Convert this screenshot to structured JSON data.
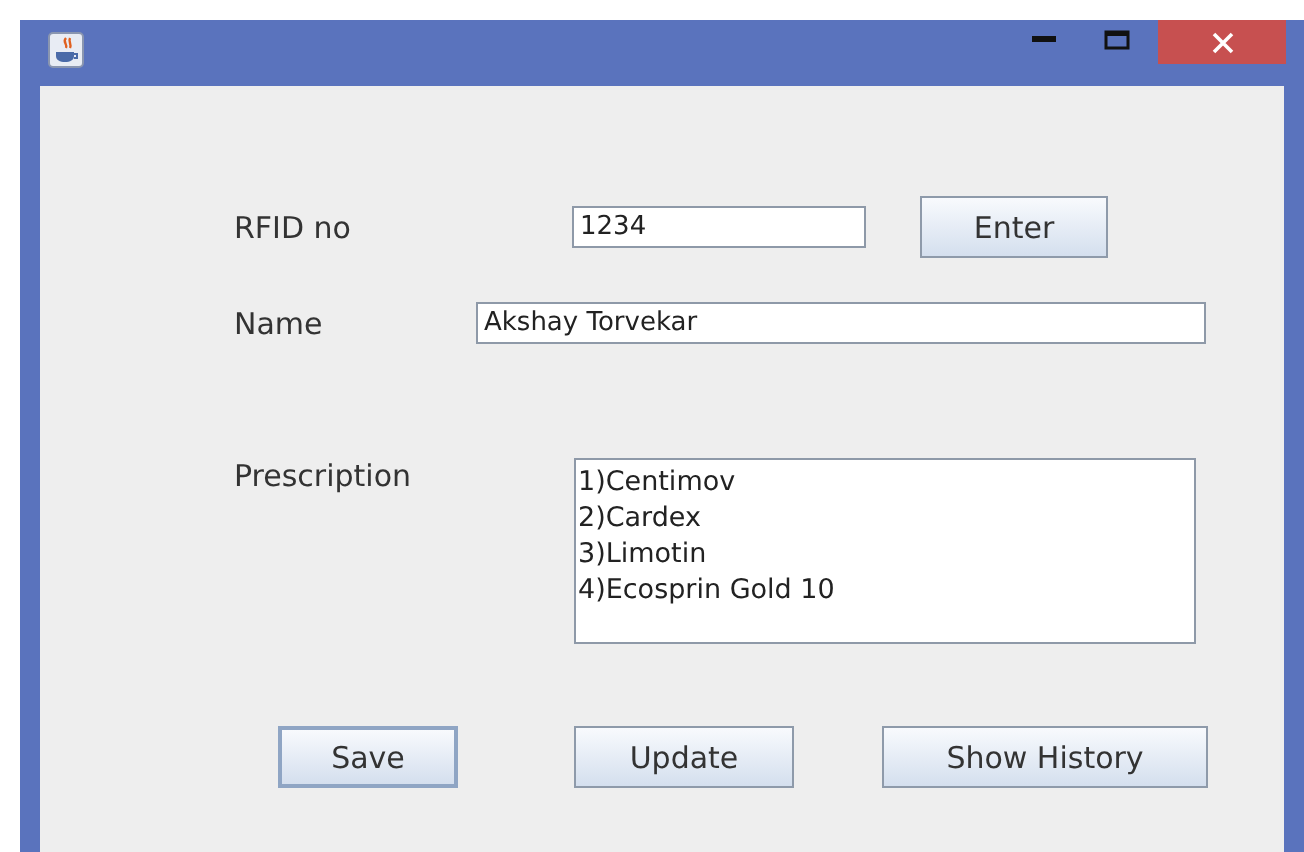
{
  "rfid": {
    "label": "RFID no",
    "value": "1234",
    "button": "Enter"
  },
  "name": {
    "label": "Name",
    "value": "Akshay Torvekar"
  },
  "prescription": {
    "label": "Prescription",
    "lines": [
      "1)Centimov",
      "2)Cardex",
      "3)Limotin",
      "4)Ecosprin Gold 10"
    ]
  },
  "buttons": [
    {
      "label": "Save",
      "focused": true
    },
    {
      "label": "Update",
      "focused": false
    },
    {
      "label": "Show History",
      "focused": false
    }
  ]
}
